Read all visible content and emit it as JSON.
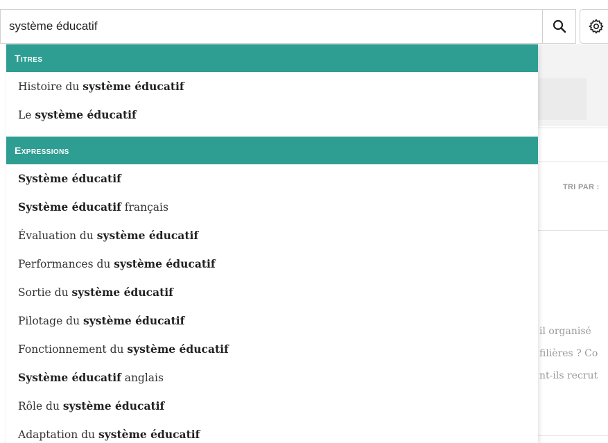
{
  "search": {
    "value": "système éducatif",
    "placeholder": ""
  },
  "icons": {
    "search": "search-icon",
    "settings": "gear-icon"
  },
  "colors": {
    "accent": "#2e9e92",
    "text": "#333333"
  },
  "background": {
    "sort_label": "TRI PAR :",
    "text_lines": [
      "il organisé",
      "filières ? Co",
      "nt-ils recrut"
    ]
  },
  "dropdown": {
    "sections": [
      {
        "title": "Titres",
        "items": [
          {
            "prefix": "Histoire du ",
            "match": "système éducatif",
            "suffix": ""
          },
          {
            "prefix": "Le ",
            "match": "système éducatif",
            "suffix": ""
          }
        ]
      },
      {
        "title": "Expressions",
        "items": [
          {
            "prefix": "",
            "match": "Système éducatif",
            "suffix": ""
          },
          {
            "prefix": "",
            "match": "Système éducatif",
            "suffix": " français"
          },
          {
            "prefix": "Évaluation du ",
            "match": "système éducatif",
            "suffix": ""
          },
          {
            "prefix": "Performances du ",
            "match": "système éducatif",
            "suffix": ""
          },
          {
            "prefix": "Sortie du ",
            "match": "système éducatif",
            "suffix": ""
          },
          {
            "prefix": "Pilotage du ",
            "match": "système éducatif",
            "suffix": ""
          },
          {
            "prefix": "Fonctionnement du ",
            "match": "système éducatif",
            "suffix": ""
          },
          {
            "prefix": "",
            "match": "Système éducatif",
            "suffix": " anglais"
          },
          {
            "prefix": "Rôle du ",
            "match": "système éducatif",
            "suffix": ""
          },
          {
            "prefix": "Adaptation du ",
            "match": "système éducatif",
            "suffix": ""
          }
        ]
      }
    ]
  }
}
